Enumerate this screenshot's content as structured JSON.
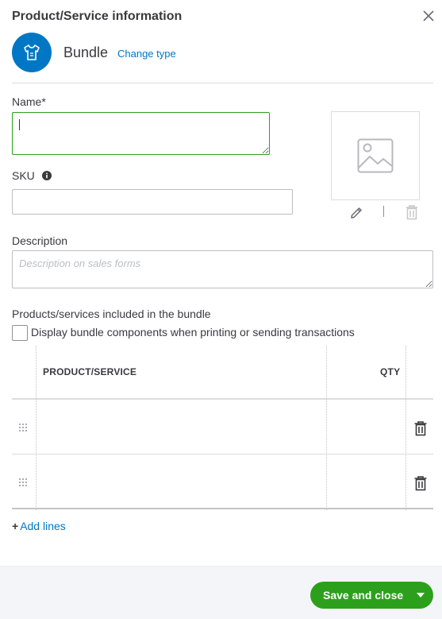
{
  "dialog": {
    "title": "Product/Service information"
  },
  "item_type": {
    "label": "Bundle",
    "change_link": "Change type",
    "icon": "tshirt-icon"
  },
  "form": {
    "name_label": "Name*",
    "name_value": "",
    "sku_label": "SKU",
    "sku_value": "",
    "description_label": "Description",
    "description_placeholder": "Description on sales forms",
    "description_value": ""
  },
  "bundle": {
    "section_label": "Products/services included in the bundle",
    "checkbox_label": "Display bundle components when printing or sending transactions",
    "checkbox_checked": false,
    "columns": [
      "PRODUCT/SERVICE",
      "QTY"
    ],
    "rows": [
      {
        "product": "",
        "qty": ""
      },
      {
        "product": "",
        "qty": ""
      }
    ],
    "add_lines_label": "Add lines"
  },
  "footer": {
    "save_label": "Save and close"
  },
  "colors": {
    "accent": "#0077c5",
    "primary_button": "#2ca01c",
    "focus_border": "#2ca01c"
  }
}
